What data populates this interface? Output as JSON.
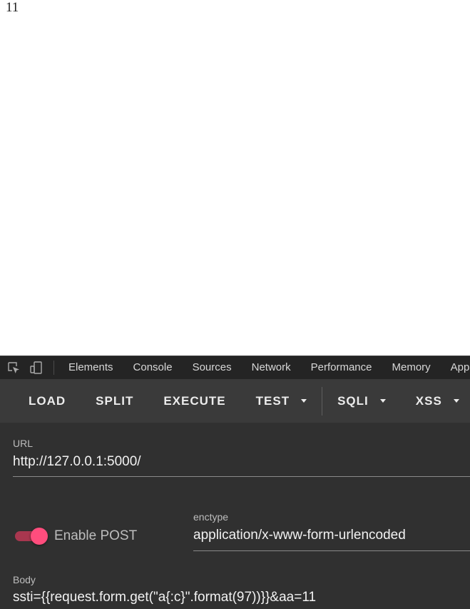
{
  "page": {
    "output_text": "11"
  },
  "devtools": {
    "tabs": [
      "Elements",
      "Console",
      "Sources",
      "Network",
      "Performance",
      "Memory",
      "Application"
    ],
    "icons": [
      "inspect-element-icon",
      "device-toggle-icon"
    ]
  },
  "hackbar": {
    "toolbar": {
      "load": "LOAD",
      "split": "SPLIT",
      "execute": "EXECUTE",
      "test": "TEST",
      "sqli": "SQLI",
      "xss": "XSS"
    },
    "url": {
      "label": "URL",
      "value": "http://127.0.0.1:5000/"
    },
    "enable_post": {
      "label": "Enable POST",
      "enabled": true
    },
    "enctype": {
      "label": "enctype",
      "value": "application/x-www-form-urlencoded"
    },
    "body": {
      "label": "Body",
      "value": "ssti={{request.form.get(\"a{:c}\".format(97))}}&aa=11"
    }
  },
  "colors": {
    "accent": "#ff4d7d",
    "toolbar_bg": "#3a3a3a",
    "form_bg": "#303030",
    "tabs_bg": "#242424"
  }
}
